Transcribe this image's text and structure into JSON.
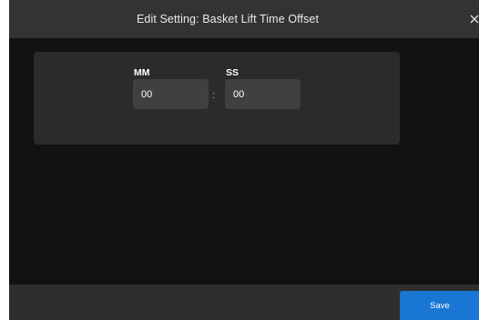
{
  "dialog": {
    "title": "Edit Setting: Basket Lift Time Offset",
    "close_icon": "close-icon"
  },
  "time_fields": {
    "minutes": {
      "label": "MM",
      "value": "00"
    },
    "separator": ":",
    "seconds": {
      "label": "SS",
      "value": "00"
    }
  },
  "footer": {
    "save_label": "Save"
  },
  "colors": {
    "accent": "#1976d2",
    "header_bg": "#333333",
    "body_bg": "#121212",
    "panel_bg": "#2b2b2b",
    "input_bg": "#404040"
  }
}
